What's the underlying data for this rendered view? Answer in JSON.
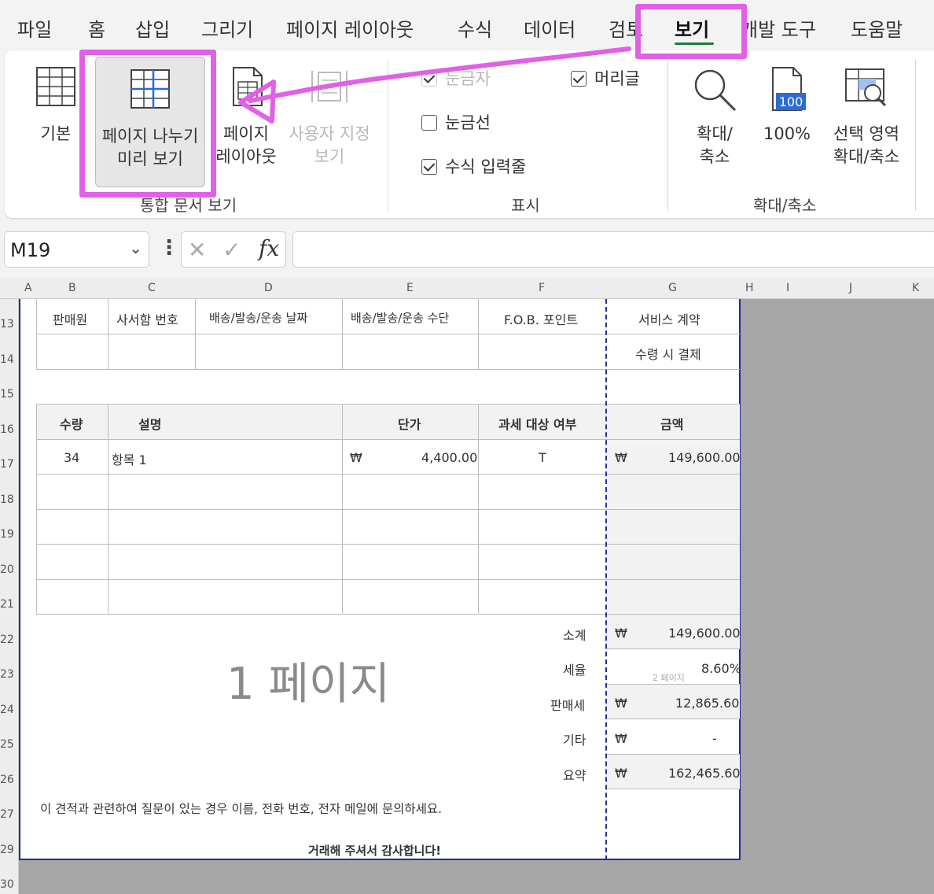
{
  "tabs": [
    "파일",
    "홈",
    "삽입",
    "그리기",
    "페이지 레이아웃",
    "수식",
    "데이터",
    "검토",
    "보기",
    "개발 도구",
    "도움말"
  ],
  "active_tab": "보기",
  "ribbon": {
    "workbook_views": {
      "normal": "기본",
      "page_break_line1": "페이지 나누기",
      "page_break_line2": "미리 보기",
      "page_layout_line1": "페이지",
      "page_layout_line2": "레이아웃",
      "custom_line1": "사용자 지정",
      "custom_line2": "보기",
      "group_label": "통합 문서 보기"
    },
    "show": {
      "ruler": "눈금자",
      "gridlines": "눈금선",
      "formula_bar": "수식 입력줄",
      "headings": "머리글",
      "group_label": "표시"
    },
    "zoom": {
      "zoom_line1": "확대/",
      "zoom_line2": "축소",
      "hundred": "100%",
      "hundred_icon_text": "100",
      "selection_line1": "선택 영역",
      "selection_line2": "확대/축소",
      "group_label": "확대/축소"
    }
  },
  "formula_bar": {
    "name_box": "M19",
    "fx": "fx",
    "formula": ""
  },
  "columns": [
    "A",
    "B",
    "C",
    "D",
    "E",
    "F",
    "G",
    "H",
    "I",
    "J",
    "K"
  ],
  "rows": [
    "13",
    "14",
    "15",
    "16",
    "17",
    "18",
    "19",
    "20",
    "21",
    "22",
    "23",
    "24",
    "25",
    "26",
    "27",
    "29",
    "30"
  ],
  "sheet": {
    "header_row": [
      "판매원",
      "사서함 번호",
      "배송/발송/운송 날짜",
      "배송/발송/운송 수단",
      "F.O.B. 포인트",
      "서비스 계약"
    ],
    "payment_terms": "수령 시 결제",
    "page1_label": "1 페이지",
    "page2_label": "2 페이지",
    "item_header": {
      "qty": "수량",
      "desc": "설명",
      "unit_price": "단가",
      "taxable": "과세 대상 여부",
      "amount": "금액"
    },
    "item": {
      "qty": "34",
      "desc": "항목 1",
      "currency": "₩",
      "unit_price": "4,400.00",
      "taxable": "T",
      "amount": "149,600.00"
    },
    "totals": [
      {
        "label": "소계",
        "currency": "₩",
        "value": "149,600.00"
      },
      {
        "label": "세율",
        "currency": "",
        "value": "8.60%"
      },
      {
        "label": "판매세",
        "currency": "₩",
        "value": "12,865.60"
      },
      {
        "label": "기타",
        "currency": "₩",
        "value": "-"
      },
      {
        "label": "요약",
        "currency": "₩",
        "value": "162,465.60"
      }
    ],
    "questions_note": "이 견적과 관련하여 질문이 있는 경우 이름, 전화 번호, 전자 메일에 문의하세요.",
    "thanks": "거래해 주셔서 감사합니다!"
  },
  "annotation_color": "#e060e8"
}
